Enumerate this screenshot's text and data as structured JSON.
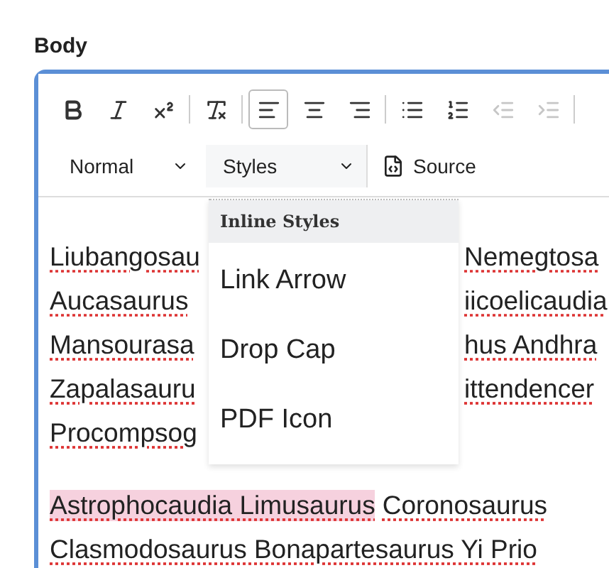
{
  "field_label": "Body",
  "toolbar": [
    {
      "kind": "bold",
      "selected": false,
      "disabled": false
    },
    {
      "kind": "italic",
      "selected": false,
      "disabled": false
    },
    {
      "kind": "superscript",
      "selected": false,
      "disabled": false
    },
    {
      "kind": "separator"
    },
    {
      "kind": "remove-format",
      "selected": false,
      "disabled": false
    },
    {
      "kind": "separator"
    },
    {
      "kind": "align-left",
      "selected": true,
      "disabled": false
    },
    {
      "kind": "align-center",
      "selected": false,
      "disabled": false
    },
    {
      "kind": "align-right",
      "selected": false,
      "disabled": false
    },
    {
      "kind": "separator"
    },
    {
      "kind": "bullet-list",
      "selected": false,
      "disabled": false
    },
    {
      "kind": "numbered-list",
      "selected": false,
      "disabled": false
    },
    {
      "kind": "outdent",
      "selected": false,
      "disabled": true
    },
    {
      "kind": "indent",
      "selected": false,
      "disabled": true
    },
    {
      "kind": "separator"
    }
  ],
  "format_select": {
    "value": "Normal"
  },
  "styles_select": {
    "value": "Styles",
    "expanded": true
  },
  "source_button": {
    "label": "Source"
  },
  "styles_menu": {
    "header": "Inline Styles",
    "items": [
      "Link Arrow",
      "Drop Cap",
      "PDF Icon"
    ]
  },
  "paragraphs": [
    {
      "lines": [
        {
          "left": "Liubangosau",
          "right": "Nemegtosa"
        },
        {
          "left": "Aucasaurus",
          "right": "iicoelicaudia"
        },
        {
          "left": "Mansourasa",
          "right": "hus Andhra"
        },
        {
          "left": "Zapalasauru",
          "right": "ittendencer"
        },
        {
          "left": "Procompsog"
        }
      ]
    },
    {
      "lines": [
        {
          "segments": [
            {
              "text": "Astrophocaudia Limusaurus",
              "highlighted": true
            },
            {
              "text": "Coronosaurus",
              "highlighted": false
            }
          ]
        },
        {
          "segments": [
            {
              "text": "Clasmodosaurus Bonapartesaurus Yi Prio",
              "highlighted": false
            }
          ]
        }
      ]
    }
  ]
}
